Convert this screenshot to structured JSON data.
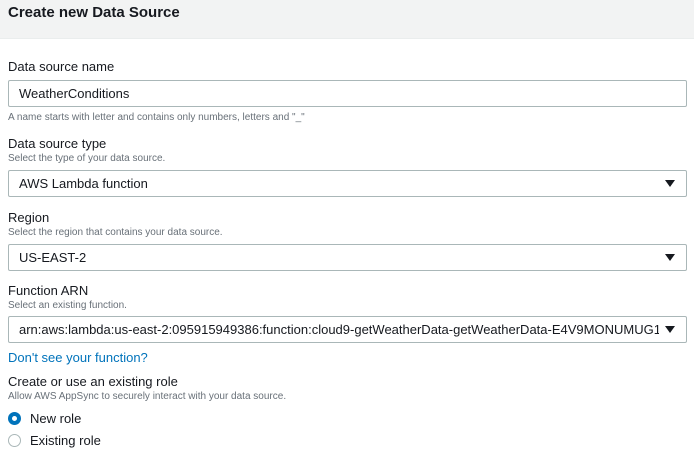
{
  "header": {
    "title": "Create new Data Source"
  },
  "name_section": {
    "label": "Data source name",
    "value": "WeatherConditions",
    "hint": "A name starts with letter and contains only numbers, letters and \"_\""
  },
  "type_section": {
    "label": "Data source type",
    "description": "Select the type of your data source.",
    "selected": "AWS Lambda function",
    "icon": "chevron-down-icon"
  },
  "region_section": {
    "label": "Region",
    "description": "Select the region that contains your data source.",
    "selected": "US-EAST-2"
  },
  "function_section": {
    "label": "Function ARN",
    "description": "Select an existing function.",
    "selected": "arn:aws:lambda:us-east-2:095915949386:function:cloud9-getWeatherData-getWeatherData-E4V9MONUMUG1",
    "help_link": "Don't see your function?"
  },
  "role_section": {
    "label": "Create or use an existing role",
    "description": "Allow AWS AppSync to securely interact with your data source.",
    "options": [
      {
        "label": "New role",
        "checked": true
      },
      {
        "label": "Existing role",
        "checked": false
      }
    ]
  },
  "colors": {
    "link": "#0073bb",
    "radio_selected": "#0073bb",
    "header_bg": "#f2f3f3"
  }
}
